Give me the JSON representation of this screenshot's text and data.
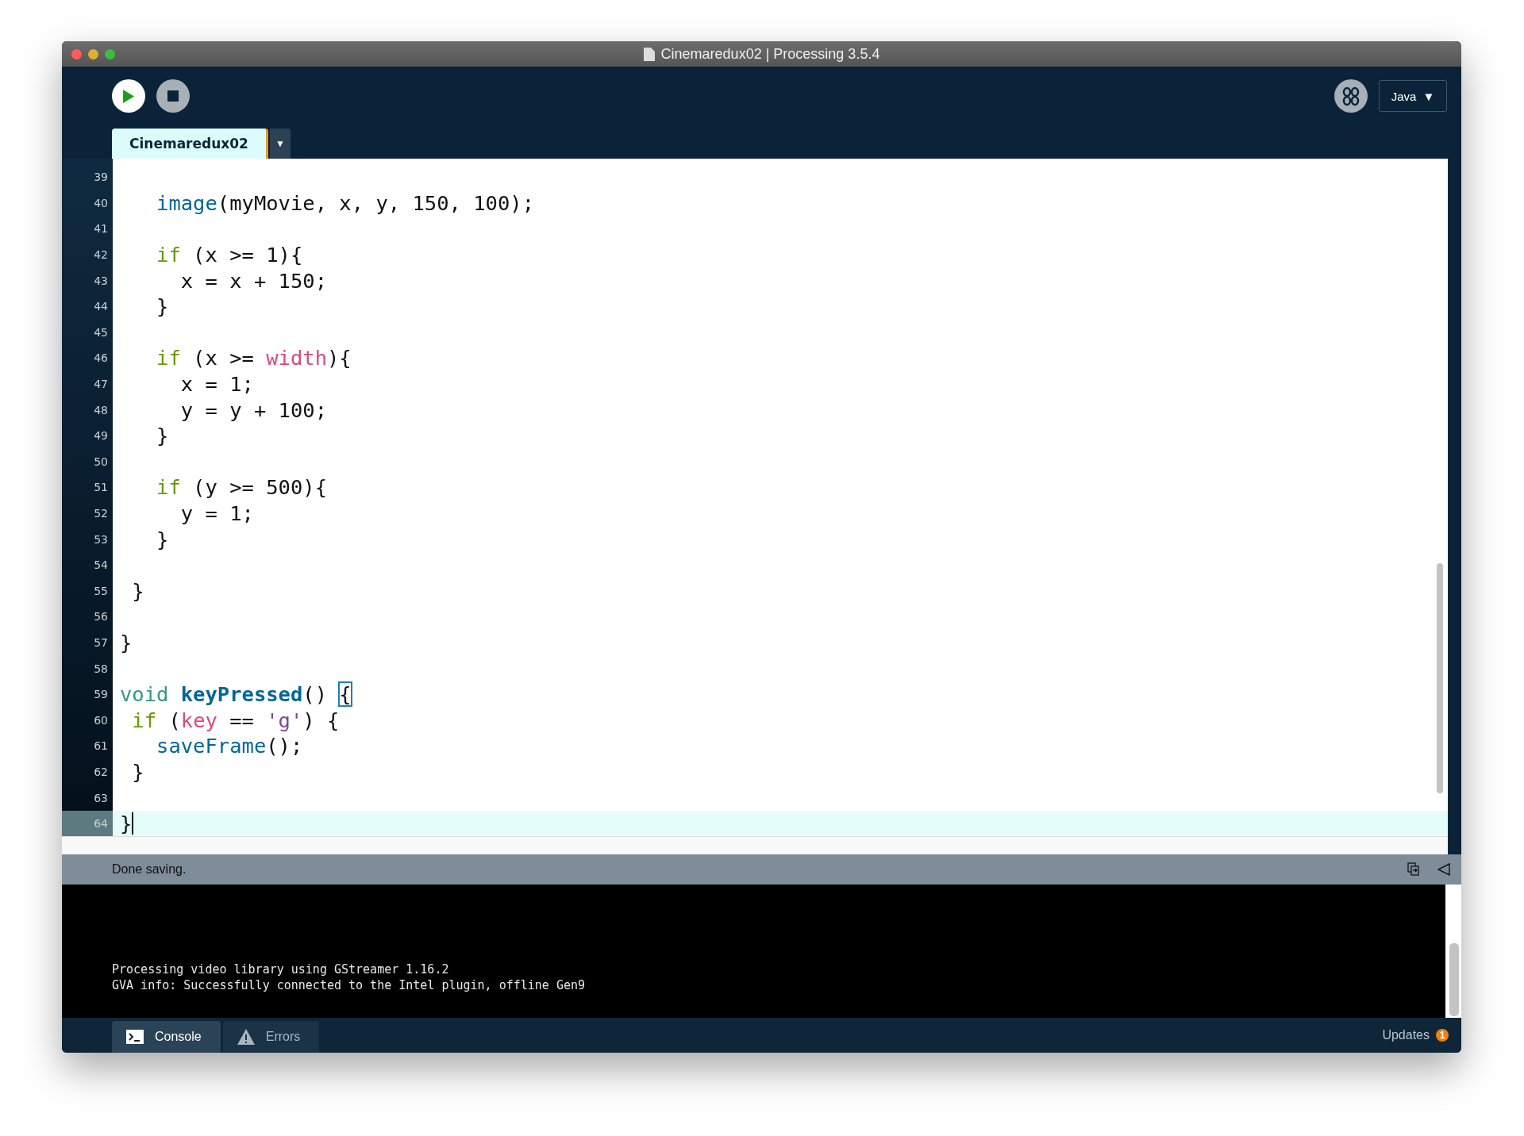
{
  "window": {
    "title": "Cinemaredux02 | Processing 3.5.4"
  },
  "toolbar": {
    "mode": "Java",
    "mode_caret": "▼"
  },
  "tabs": [
    {
      "label": "Cinemaredux02",
      "selected": true
    }
  ],
  "tab_menu": "▼",
  "editor": {
    "lines": [
      {
        "number": "39",
        "current": false
      },
      {
        "number": "40",
        "current": false,
        "tokens": [
          {
            "text": "   image",
            "kind": "function"
          },
          {
            "text": "(myMovie, x, y, 150, 100);",
            "kind": "plain"
          }
        ]
      },
      {
        "number": "41",
        "current": false
      },
      {
        "number": "42",
        "current": false,
        "tokens": [
          {
            "text": "   if",
            "kind": "keyword"
          },
          {
            "text": " (x >= 1){",
            "kind": "plain"
          }
        ]
      },
      {
        "number": "43",
        "current": false,
        "tokens": [
          {
            "text": "     x = x + 150;",
            "kind": "plain"
          }
        ]
      },
      {
        "number": "44",
        "current": false,
        "tokens": [
          {
            "text": "   }",
            "kind": "plain"
          }
        ]
      },
      {
        "number": "45",
        "current": false
      },
      {
        "number": "46",
        "current": false,
        "tokens": [
          {
            "text": "   if",
            "kind": "keyword"
          },
          {
            "text": " (x >= ",
            "kind": "plain"
          },
          {
            "text": "width",
            "kind": "variable"
          },
          {
            "text": "){",
            "kind": "plain"
          }
        ]
      },
      {
        "number": "47",
        "current": false,
        "tokens": [
          {
            "text": "     x = 1;",
            "kind": "plain"
          }
        ]
      },
      {
        "number": "48",
        "current": false,
        "tokens": [
          {
            "text": "     y = y + 100;",
            "kind": "plain"
          }
        ]
      },
      {
        "number": "49",
        "current": false,
        "tokens": [
          {
            "text": "   }",
            "kind": "plain"
          }
        ]
      },
      {
        "number": "50",
        "current": false
      },
      {
        "number": "51",
        "current": false,
        "tokens": [
          {
            "text": "   if",
            "kind": "keyword"
          },
          {
            "text": " (y >= 500){",
            "kind": "plain"
          }
        ]
      },
      {
        "number": "52",
        "current": false,
        "tokens": [
          {
            "text": "     y = 1;",
            "kind": "plain"
          }
        ]
      },
      {
        "number": "53",
        "current": false,
        "tokens": [
          {
            "text": "   }",
            "kind": "plain"
          }
        ]
      },
      {
        "number": "54",
        "current": false
      },
      {
        "number": "55",
        "current": false,
        "tokens": [
          {
            "text": " }",
            "kind": "plain"
          }
        ]
      },
      {
        "number": "56",
        "current": false
      },
      {
        "number": "57",
        "current": false,
        "tokens": [
          {
            "text": "}",
            "kind": "plain"
          }
        ]
      },
      {
        "number": "58",
        "current": false
      },
      {
        "number": "59",
        "current": false,
        "tokens": [
          {
            "text": "void ",
            "kind": "type"
          },
          {
            "text": "keyPressed",
            "kind": "method"
          },
          {
            "text": "() ",
            "kind": "plain"
          },
          {
            "text": "{",
            "kind": "bracket_match"
          }
        ]
      },
      {
        "number": "60",
        "current": false,
        "tokens": [
          {
            "text": " if",
            "kind": "keyword"
          },
          {
            "text": " (",
            "kind": "plain"
          },
          {
            "text": "key",
            "kind": "variable"
          },
          {
            "text": " == ",
            "kind": "plain"
          },
          {
            "text": "'g'",
            "kind": "string"
          },
          {
            "text": ") {",
            "kind": "plain"
          }
        ]
      },
      {
        "number": "61",
        "current": false,
        "tokens": [
          {
            "text": "   saveFrame",
            "kind": "function"
          },
          {
            "text": "();",
            "kind": "plain"
          }
        ]
      },
      {
        "number": "62",
        "current": false,
        "tokens": [
          {
            "text": " }",
            "kind": "plain"
          }
        ]
      },
      {
        "number": "63",
        "current": false
      },
      {
        "number": "64",
        "current": true,
        "tokens": [
          {
            "text": "}",
            "kind": "plain"
          }
        ]
      }
    ]
  },
  "status": {
    "message": "Done saving."
  },
  "console": {
    "lines": [
      "Processing video library using GStreamer 1.16.2",
      "GVA info: Successfully connected to the Intel plugin, offline Gen9"
    ]
  },
  "footer_tabs": [
    {
      "label": "Console",
      "kind": "console",
      "selected": true
    },
    {
      "label": "Errors",
      "kind": "errors",
      "selected": false
    }
  ],
  "updates": {
    "label": "Updates",
    "count": "1"
  }
}
